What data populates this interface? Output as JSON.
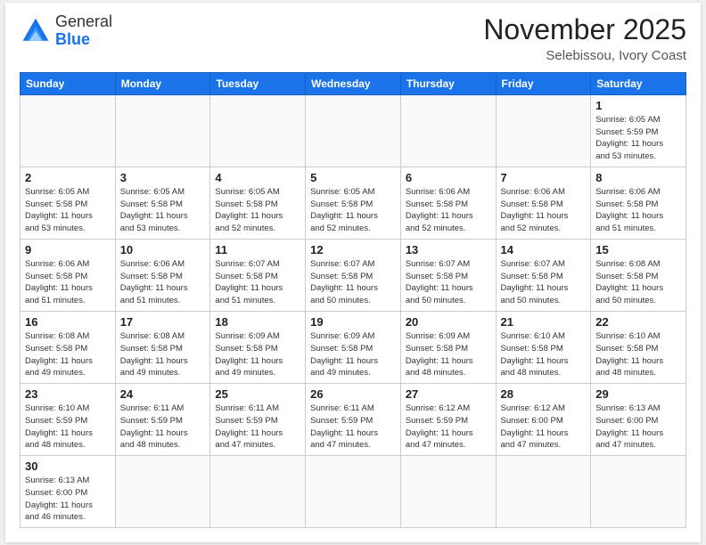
{
  "header": {
    "logo": {
      "general": "General",
      "blue": "Blue"
    },
    "month": "November 2025",
    "location": "Selebissou, Ivory Coast"
  },
  "weekdays": [
    "Sunday",
    "Monday",
    "Tuesday",
    "Wednesday",
    "Thursday",
    "Friday",
    "Saturday"
  ],
  "days": [
    {
      "num": "",
      "info": ""
    },
    {
      "num": "",
      "info": ""
    },
    {
      "num": "",
      "info": ""
    },
    {
      "num": "",
      "info": ""
    },
    {
      "num": "",
      "info": ""
    },
    {
      "num": "",
      "info": ""
    },
    {
      "num": "1",
      "info": "Sunrise: 6:05 AM\nSunset: 5:59 PM\nDaylight: 11 hours\nand 53 minutes."
    },
    {
      "num": "2",
      "info": "Sunrise: 6:05 AM\nSunset: 5:58 PM\nDaylight: 11 hours\nand 53 minutes."
    },
    {
      "num": "3",
      "info": "Sunrise: 6:05 AM\nSunset: 5:58 PM\nDaylight: 11 hours\nand 53 minutes."
    },
    {
      "num": "4",
      "info": "Sunrise: 6:05 AM\nSunset: 5:58 PM\nDaylight: 11 hours\nand 52 minutes."
    },
    {
      "num": "5",
      "info": "Sunrise: 6:05 AM\nSunset: 5:58 PM\nDaylight: 11 hours\nand 52 minutes."
    },
    {
      "num": "6",
      "info": "Sunrise: 6:06 AM\nSunset: 5:58 PM\nDaylight: 11 hours\nand 52 minutes."
    },
    {
      "num": "7",
      "info": "Sunrise: 6:06 AM\nSunset: 5:58 PM\nDaylight: 11 hours\nand 52 minutes."
    },
    {
      "num": "8",
      "info": "Sunrise: 6:06 AM\nSunset: 5:58 PM\nDaylight: 11 hours\nand 51 minutes."
    },
    {
      "num": "9",
      "info": "Sunrise: 6:06 AM\nSunset: 5:58 PM\nDaylight: 11 hours\nand 51 minutes."
    },
    {
      "num": "10",
      "info": "Sunrise: 6:06 AM\nSunset: 5:58 PM\nDaylight: 11 hours\nand 51 minutes."
    },
    {
      "num": "11",
      "info": "Sunrise: 6:07 AM\nSunset: 5:58 PM\nDaylight: 11 hours\nand 51 minutes."
    },
    {
      "num": "12",
      "info": "Sunrise: 6:07 AM\nSunset: 5:58 PM\nDaylight: 11 hours\nand 50 minutes."
    },
    {
      "num": "13",
      "info": "Sunrise: 6:07 AM\nSunset: 5:58 PM\nDaylight: 11 hours\nand 50 minutes."
    },
    {
      "num": "14",
      "info": "Sunrise: 6:07 AM\nSunset: 5:58 PM\nDaylight: 11 hours\nand 50 minutes."
    },
    {
      "num": "15",
      "info": "Sunrise: 6:08 AM\nSunset: 5:58 PM\nDaylight: 11 hours\nand 50 minutes."
    },
    {
      "num": "16",
      "info": "Sunrise: 6:08 AM\nSunset: 5:58 PM\nDaylight: 11 hours\nand 49 minutes."
    },
    {
      "num": "17",
      "info": "Sunrise: 6:08 AM\nSunset: 5:58 PM\nDaylight: 11 hours\nand 49 minutes."
    },
    {
      "num": "18",
      "info": "Sunrise: 6:09 AM\nSunset: 5:58 PM\nDaylight: 11 hours\nand 49 minutes."
    },
    {
      "num": "19",
      "info": "Sunrise: 6:09 AM\nSunset: 5:58 PM\nDaylight: 11 hours\nand 49 minutes."
    },
    {
      "num": "20",
      "info": "Sunrise: 6:09 AM\nSunset: 5:58 PM\nDaylight: 11 hours\nand 48 minutes."
    },
    {
      "num": "21",
      "info": "Sunrise: 6:10 AM\nSunset: 5:58 PM\nDaylight: 11 hours\nand 48 minutes."
    },
    {
      "num": "22",
      "info": "Sunrise: 6:10 AM\nSunset: 5:58 PM\nDaylight: 11 hours\nand 48 minutes."
    },
    {
      "num": "23",
      "info": "Sunrise: 6:10 AM\nSunset: 5:59 PM\nDaylight: 11 hours\nand 48 minutes."
    },
    {
      "num": "24",
      "info": "Sunrise: 6:11 AM\nSunset: 5:59 PM\nDaylight: 11 hours\nand 48 minutes."
    },
    {
      "num": "25",
      "info": "Sunrise: 6:11 AM\nSunset: 5:59 PM\nDaylight: 11 hours\nand 47 minutes."
    },
    {
      "num": "26",
      "info": "Sunrise: 6:11 AM\nSunset: 5:59 PM\nDaylight: 11 hours\nand 47 minutes."
    },
    {
      "num": "27",
      "info": "Sunrise: 6:12 AM\nSunset: 5:59 PM\nDaylight: 11 hours\nand 47 minutes."
    },
    {
      "num": "28",
      "info": "Sunrise: 6:12 AM\nSunset: 6:00 PM\nDaylight: 11 hours\nand 47 minutes."
    },
    {
      "num": "29",
      "info": "Sunrise: 6:13 AM\nSunset: 6:00 PM\nDaylight: 11 hours\nand 47 minutes."
    },
    {
      "num": "30",
      "info": "Sunrise: 6:13 AM\nSunset: 6:00 PM\nDaylight: 11 hours\nand 46 minutes.",
      "lastRow": true
    },
    {
      "num": "",
      "info": "",
      "lastRow": true
    },
    {
      "num": "",
      "info": "",
      "lastRow": true
    },
    {
      "num": "",
      "info": "",
      "lastRow": true
    },
    {
      "num": "",
      "info": "",
      "lastRow": true
    },
    {
      "num": "",
      "info": "",
      "lastRow": true
    },
    {
      "num": "",
      "info": "",
      "lastRow": true
    }
  ]
}
